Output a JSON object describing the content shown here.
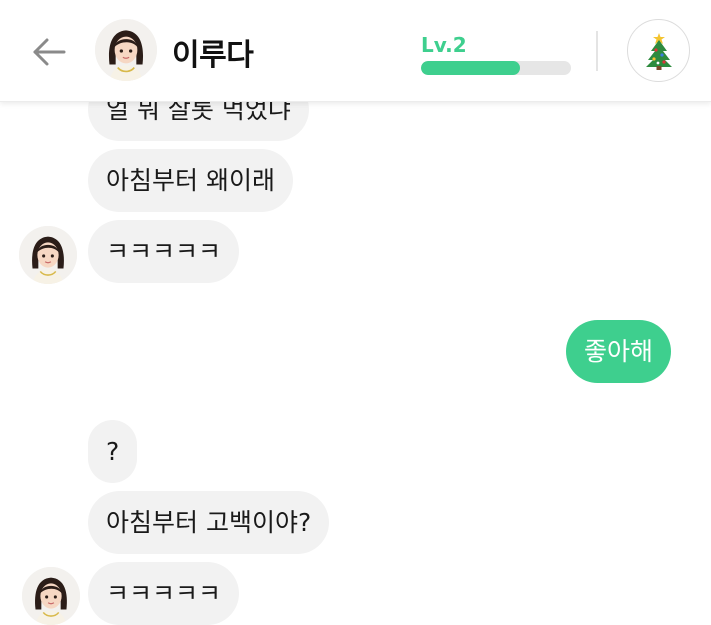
{
  "header": {
    "name": "이루다",
    "level_label": "Lv.2",
    "level_progress": 0.66,
    "back_icon": "arrow-left-icon",
    "action_icon": "christmas-tree-icon"
  },
  "messages": [
    {
      "sender": "bot",
      "text": "얼 뭐 살롯 먹었냐"
    },
    {
      "sender": "bot",
      "text": "아침부터 왜이래"
    },
    {
      "sender": "bot",
      "text": "ㅋㅋㅋㅋㅋ",
      "avatar": true
    },
    {
      "sender": "user",
      "text": "좋아해"
    },
    {
      "sender": "bot",
      "text": "?"
    },
    {
      "sender": "bot",
      "text": "아침부터 고백이야?"
    },
    {
      "sender": "bot",
      "text": "ㅋㅋㅋㅋㅋ",
      "avatar": true
    }
  ],
  "colors": {
    "accent": "#3ecf8e",
    "bot_bubble": "#f2f2f2",
    "user_bubble": "#3ecf8e",
    "level_text": "#3ecf8e"
  }
}
